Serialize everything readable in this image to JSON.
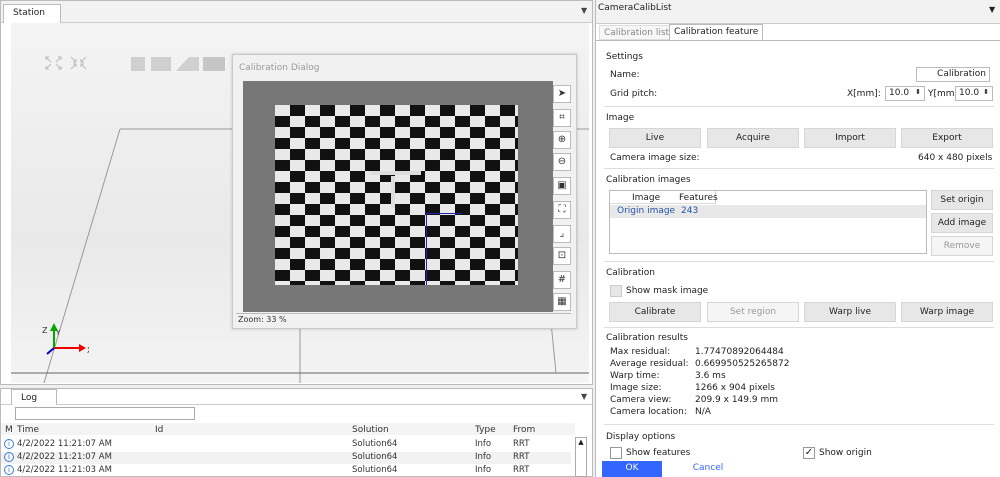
{
  "station": {
    "tab": "Station"
  },
  "dialog": {
    "title": "Calibration Dialog",
    "zoom": "Zoom: 33 %"
  },
  "log": {
    "tab": "Log",
    "filter_value": "",
    "columns": [
      "M",
      "Time",
      "Id",
      "Solution",
      "Type",
      "From"
    ],
    "rows": [
      {
        "time": "4/2/2022 11:21:07 AM",
        "id": "",
        "solution": "Solution64",
        "type": "Info",
        "from": "RRT"
      },
      {
        "time": "4/2/2022 11:21:07 AM",
        "id": "",
        "solution": "Solution64",
        "type": "Info",
        "from": "RRT"
      },
      {
        "time": "4/2/2022 11:21:03 AM",
        "id": "",
        "solution": "Solution64",
        "type": "Info",
        "from": "RRT"
      }
    ]
  },
  "panel": {
    "title": "CameraCalibList",
    "tabs": [
      "Calibration list",
      "Calibration feature"
    ],
    "settings": {
      "heading": "Settings",
      "name_label": "Name:",
      "name_value": "Calibration",
      "grid_label": "Grid pitch:",
      "x_label": "X[mm]:",
      "x_value": "10.0",
      "y_label": "Y[mm]:",
      "y_value": "10.0"
    },
    "image": {
      "heading": "Image",
      "buttons": [
        "Live",
        "Acquire",
        "Import",
        "Export"
      ],
      "size_label": "Camera image size:",
      "size_value": "640 x 480 pixels"
    },
    "calib_images": {
      "heading": "Calibration images",
      "col_image": "Image",
      "col_features": "Features",
      "row_image": "Origin image",
      "row_features": "243",
      "set_origin": "Set origin",
      "add_image": "Add image",
      "remove": "Remove"
    },
    "calibration": {
      "heading": "Calibration",
      "show_mask": "Show mask image",
      "buttons": [
        "Calibrate",
        "Set region",
        "Warp live",
        "Warp image"
      ]
    },
    "results": {
      "heading": "Calibration results",
      "items": [
        {
          "label": "Max residual:",
          "value": "1.77470892064484"
        },
        {
          "label": "Average residual:",
          "value": "0.669950525265872"
        },
        {
          "label": "Warp time:",
          "value": "3.6 ms"
        },
        {
          "label": "Image size:",
          "value": "1266 x 904 pixels"
        },
        {
          "label": "Camera view:",
          "value": "209.9 x 149.9 mm"
        },
        {
          "label": "Camera location:",
          "value": "N/A"
        }
      ]
    },
    "display": {
      "heading": "Display options",
      "show_features": "Show features",
      "show_origin": "Show origin"
    },
    "ok": "OK",
    "cancel": "Cancel"
  }
}
